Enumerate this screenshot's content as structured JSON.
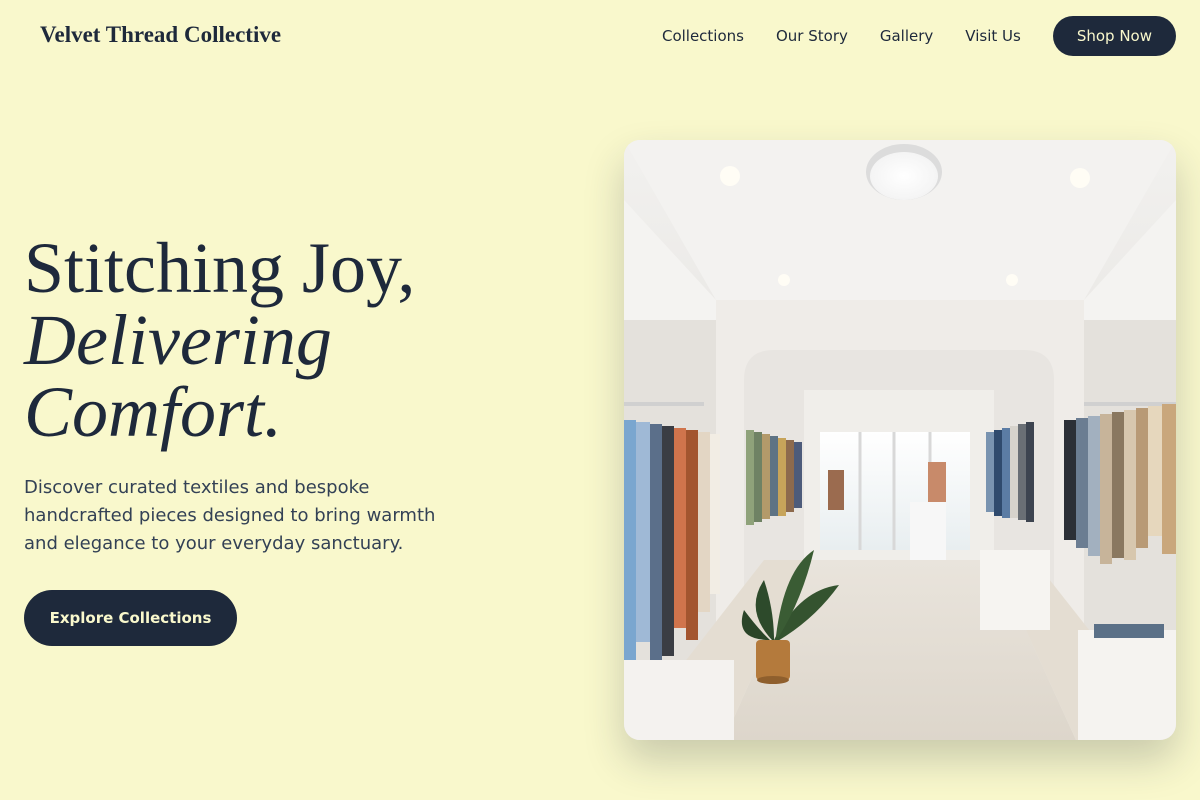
{
  "brand": {
    "name": "Velvet Thread Collective"
  },
  "nav": {
    "links": [
      "Collections",
      "Our Story",
      "Gallery",
      "Visit Us"
    ],
    "cta_label": "Shop Now"
  },
  "hero": {
    "title_line1": "Stitching Joy,",
    "title_line2": "Delivering",
    "title_line3": "Comfort.",
    "description": "Discover curated textiles and bespoke handcrafted pieces designed to bring warmth and elegance to your everyday sanctuary.",
    "cta_label": "Explore Collections"
  },
  "colors": {
    "background": "#f9f8cc",
    "primary": "#1e293b",
    "text_muted": "#334155"
  }
}
